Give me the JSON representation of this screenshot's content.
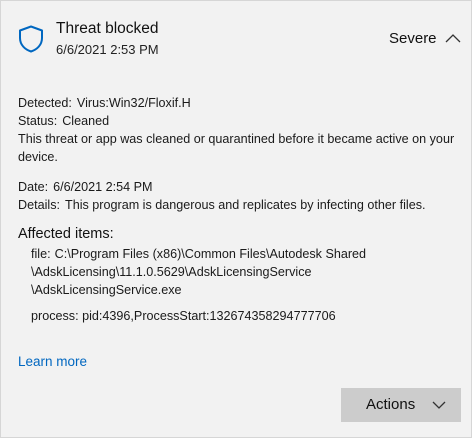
{
  "threat": {
    "title": "Threat blocked",
    "timestamp": "6/6/2021 2:53 PM",
    "severity": "Severe"
  },
  "details": {
    "detected_label": "Detected:",
    "detected_value": "Virus:Win32/Floxif.H",
    "status_label": "Status:",
    "status_value": "Cleaned",
    "status_description": "This threat or app was cleaned or quarantined before it became active on your device.",
    "date_label": "Date:",
    "date_value": "6/6/2021 2:54 PM",
    "details_label": "Details:",
    "details_value": "This program is dangerous and replicates by infecting other files."
  },
  "affected": {
    "heading": "Affected items:",
    "file_label": "file:",
    "file_path_lines": [
      "C:\\Program Files (x86)\\Common Files\\Autodesk Shared",
      "\\AdskLicensing\\11.1.0.5629\\AdskLicensingService",
      "\\AdskLicensingService.exe"
    ],
    "process_label": "process:",
    "process_value": "pid:4396,ProcessStart:132674358294777706"
  },
  "links": {
    "learn_more": "Learn more"
  },
  "buttons": {
    "actions": "Actions"
  },
  "icons": {
    "shield": "shield-icon",
    "collapse": "chevron-up-icon",
    "dropdown": "chevron-down-icon"
  },
  "colors": {
    "accent": "#0067c0",
    "card_background": "#f2f2f2",
    "button_background": "#cccccc"
  }
}
